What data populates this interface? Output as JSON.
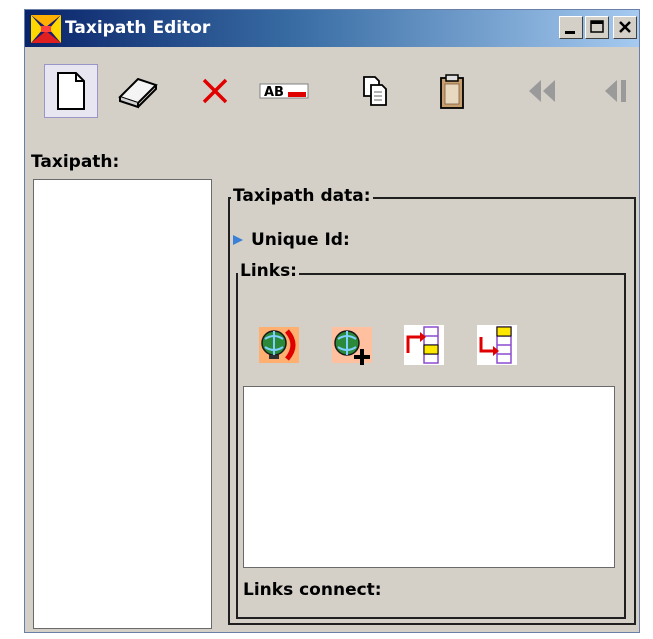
{
  "window": {
    "title": "Taxipath Editor"
  },
  "toolbar": {
    "buttons": [
      {
        "name": "new-button",
        "icon": "new-document-icon"
      },
      {
        "name": "erase-button",
        "icon": "eraser-icon"
      },
      {
        "name": "delete-button",
        "icon": "red-x-icon"
      },
      {
        "name": "rename-button",
        "icon": "rename-ab-icon",
        "text": "AB"
      },
      {
        "name": "copy-button",
        "icon": "copy-icon"
      },
      {
        "name": "paste-button",
        "icon": "clipboard-icon"
      },
      {
        "name": "first-button",
        "icon": "rewind-icon"
      },
      {
        "name": "previous-button",
        "icon": "step-back-icon"
      }
    ]
  },
  "left_panel": {
    "label": "Taxipath:"
  },
  "taxipath_data": {
    "title": "Taxipath data:",
    "unique_id_label": "Unique Id:",
    "links": {
      "title": "Links:",
      "buttons": [
        {
          "name": "link-globe-button",
          "icon": "globe-link-icon"
        },
        {
          "name": "add-globe-button",
          "icon": "globe-add-icon"
        },
        {
          "name": "link-move-button-1",
          "icon": "arrow-list-icon"
        },
        {
          "name": "link-move-button-2",
          "icon": "arrow-list-icon"
        }
      ],
      "connect_label": "Links connect:"
    }
  },
  "colors": {
    "titlebar_start": "#0a246a",
    "titlebar_end": "#a6caf0",
    "window_bg": "#d4d0c8"
  }
}
